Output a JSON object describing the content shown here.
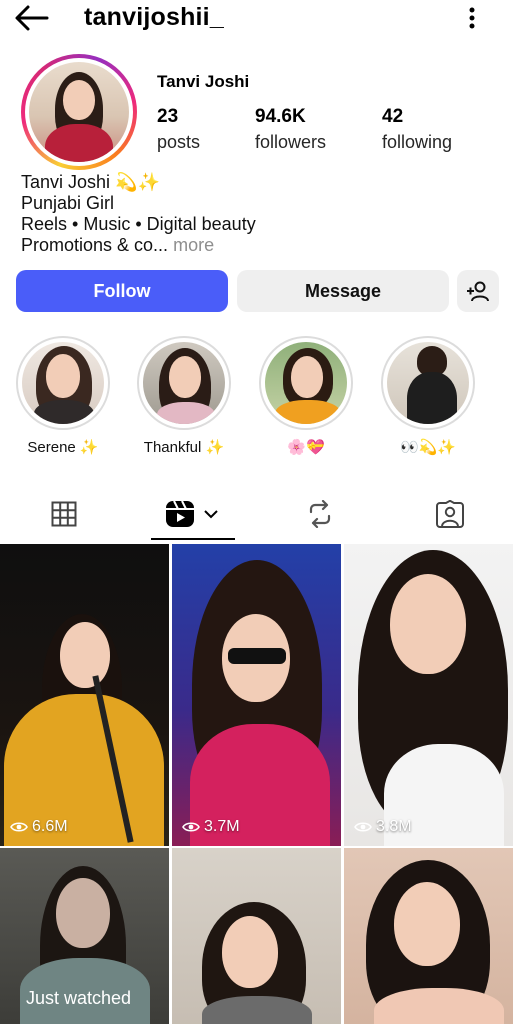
{
  "header": {
    "username": "tanvijoshii_"
  },
  "profile": {
    "name": "Tanvi Joshi",
    "stats": [
      {
        "value": "23",
        "label": "posts"
      },
      {
        "value": "94.6K",
        "label": "followers"
      },
      {
        "value": "42",
        "label": "following"
      }
    ],
    "bio": {
      "line1": "Tanvi Joshi 💫✨",
      "line2": "Punjabi Girl",
      "line3": "Reels • Music • Digital beauty",
      "line4": "Promotions & co...",
      "more": "more"
    }
  },
  "actions": {
    "follow": "Follow",
    "message": "Message"
  },
  "highlights": [
    {
      "label": "Serene ✨"
    },
    {
      "label": "Thankful ✨"
    },
    {
      "label": "🌸💝"
    },
    {
      "label": "👀💫✨"
    }
  ],
  "tabs": [
    "grid-icon",
    "reels-icon",
    "reposts-icon",
    "tagged-icon"
  ],
  "grid": [
    {
      "views": "6.6M"
    },
    {
      "views": "3.7M"
    },
    {
      "views": "3.8M"
    },
    {
      "overlay": "Just watched"
    },
    {},
    {}
  ],
  "colors": {
    "follow": "#4a5df9",
    "secondary_button": "#efefef"
  }
}
